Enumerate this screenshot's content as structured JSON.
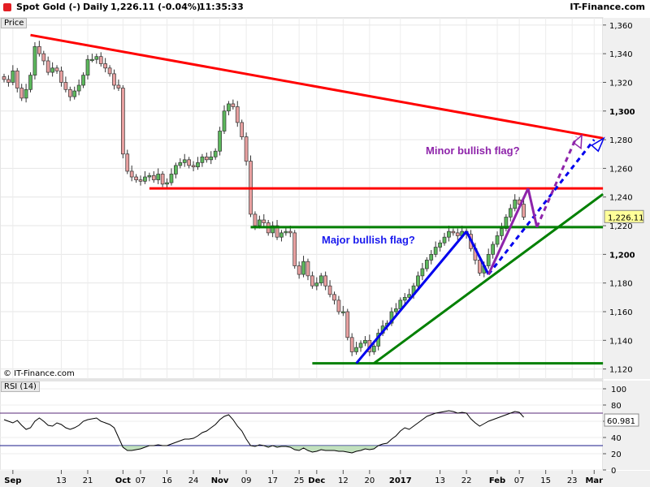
{
  "header": {
    "instrument": "Spot Gold (-)",
    "period": "Daily",
    "quote": "1,226.11 (-0.04%)",
    "time": "11:35:33",
    "brand": "IT-Finance.com"
  },
  "copyright": "© IT-Finance.com",
  "colors": {
    "up_candle": "#5cb85c",
    "down_candle": "#e8a0a0",
    "resistance": "#ff0000",
    "support": "#008000",
    "major_flag": "#0000ee",
    "minor_flag": "#8e24aa"
  },
  "chart_data": [
    {
      "type": "candlestick",
      "panel": "price",
      "ylabel": "Price",
      "ylim": [
        1113,
        1365
      ],
      "yticks": [
        1120,
        1140,
        1160,
        1180,
        1200,
        1220,
        1240,
        1260,
        1280,
        1300,
        1320,
        1340,
        1360
      ],
      "ytick_labels": [
        "1,120",
        "1,140",
        "1,160",
        "1,180",
        "1,200",
        "1,220",
        "1,240",
        "1,260",
        "1,280",
        "1,300",
        "1,320",
        "1,340",
        "1,360"
      ],
      "bold_ticks": [
        "1,200",
        "1,300"
      ],
      "xlim": [
        0,
        133
      ],
      "x_ticks": [
        {
          "i": 2,
          "label": "Sep"
        },
        {
          "i": 13,
          "label": "13"
        },
        {
          "i": 19,
          "label": "21"
        },
        {
          "i": 27,
          "label": "Oct"
        },
        {
          "i": 31,
          "label": "07"
        },
        {
          "i": 37,
          "label": "16"
        },
        {
          "i": 43,
          "label": "24"
        },
        {
          "i": 49,
          "label": "Nov"
        },
        {
          "i": 55,
          "label": "09"
        },
        {
          "i": 61,
          "label": "17"
        },
        {
          "i": 67,
          "label": "25"
        },
        {
          "i": 71,
          "label": "Dec"
        },
        {
          "i": 77,
          "label": "12"
        },
        {
          "i": 83,
          "label": "20"
        },
        {
          "i": 90,
          "label": "2017"
        },
        {
          "i": 99,
          "label": "13"
        },
        {
          "i": 105,
          "label": "22"
        },
        {
          "i": 112,
          "label": "Feb"
        },
        {
          "i": 117,
          "label": "07"
        },
        {
          "i": 123,
          "label": "15"
        },
        {
          "i": 129,
          "label": "23"
        },
        {
          "i": 134,
          "label": "Mar"
        }
      ],
      "bold_x_labels": [
        "Sep",
        "Oct",
        "Nov",
        "Dec",
        "2017",
        "Feb",
        "Mar"
      ],
      "last_price": "1,226.11",
      "close": [
        1322,
        1320,
        1328,
        1316,
        1309,
        1315,
        1325,
        1345,
        1340,
        1335,
        1327,
        1330,
        1328,
        1320,
        1315,
        1310,
        1314,
        1318,
        1325,
        1336,
        1336,
        1338,
        1333,
        1330,
        1326,
        1318,
        1316,
        1270,
        1258,
        1254,
        1252,
        1251,
        1254,
        1255,
        1252,
        1256,
        1249,
        1250,
        1256,
        1262,
        1264,
        1266,
        1262,
        1261,
        1264,
        1268,
        1266,
        1268,
        1272,
        1286,
        1300,
        1305,
        1303,
        1292,
        1282,
        1265,
        1228,
        1220,
        1224,
        1222,
        1215,
        1220,
        1212,
        1215,
        1216,
        1215,
        1192,
        1186,
        1195,
        1185,
        1178,
        1180,
        1185,
        1178,
        1172,
        1168,
        1160,
        1160,
        1142,
        1132,
        1135,
        1138,
        1140,
        1132,
        1136,
        1145,
        1150,
        1152,
        1160,
        1162,
        1168,
        1170,
        1172,
        1178,
        1185,
        1190,
        1196,
        1200,
        1205,
        1208,
        1212,
        1216,
        1215,
        1213,
        1216,
        1214,
        1204,
        1196,
        1187,
        1192,
        1200,
        1207,
        1213,
        1218,
        1226,
        1232,
        1238,
        1235,
        1226
      ],
      "open": [
        1324,
        1322,
        1320,
        1328,
        1316,
        1309,
        1315,
        1325,
        1345,
        1340,
        1335,
        1327,
        1330,
        1328,
        1320,
        1315,
        1310,
        1314,
        1318,
        1325,
        1336,
        1336,
        1338,
        1333,
        1330,
        1326,
        1318,
        1316,
        1270,
        1258,
        1254,
        1252,
        1251,
        1254,
        1255,
        1252,
        1256,
        1249,
        1250,
        1256,
        1262,
        1264,
        1266,
        1262,
        1261,
        1264,
        1268,
        1266,
        1268,
        1272,
        1286,
        1300,
        1305,
        1303,
        1292,
        1282,
        1265,
        1228,
        1220,
        1224,
        1222,
        1215,
        1220,
        1212,
        1215,
        1216,
        1215,
        1192,
        1186,
        1195,
        1185,
        1178,
        1180,
        1185,
        1178,
        1172,
        1168,
        1160,
        1160,
        1142,
        1132,
        1135,
        1138,
        1140,
        1132,
        1136,
        1145,
        1150,
        1152,
        1160,
        1162,
        1168,
        1170,
        1172,
        1178,
        1185,
        1190,
        1196,
        1200,
        1205,
        1208,
        1212,
        1216,
        1215,
        1213,
        1216,
        1214,
        1204,
        1196,
        1187,
        1192,
        1200,
        1207,
        1213,
        1218,
        1226,
        1232,
        1238,
        1235
      ]
    },
    {
      "type": "line",
      "panel": "rsi",
      "name": "RSI (14)",
      "ylim": [
        0,
        110
      ],
      "yticks": [
        0,
        20,
        40,
        60,
        80,
        100
      ],
      "ytick_labels": [
        "0",
        "20",
        "40",
        "60",
        "80",
        "100"
      ],
      "levels": [
        70,
        30
      ],
      "last_value": "60.981",
      "values": [
        62,
        60,
        58,
        61,
        55,
        50,
        52,
        60,
        64,
        60,
        55,
        54,
        58,
        56,
        52,
        50,
        52,
        55,
        60,
        62,
        63,
        64,
        60,
        58,
        56,
        52,
        40,
        28,
        24,
        24,
        25,
        26,
        28,
        30,
        30,
        31,
        30,
        30,
        32,
        34,
        36,
        38,
        38,
        39,
        42,
        46,
        48,
        52,
        56,
        62,
        66,
        68,
        62,
        54,
        48,
        38,
        30,
        29,
        31,
        30,
        28,
        30,
        28,
        29,
        29,
        28,
        25,
        24,
        27,
        24,
        22,
        23,
        25,
        24,
        24,
        24,
        23,
        23,
        22,
        21,
        23,
        24,
        26,
        25,
        26,
        30,
        32,
        33,
        38,
        42,
        48,
        52,
        50,
        54,
        58,
        62,
        66,
        68,
        70,
        71,
        72,
        73,
        72,
        70,
        71,
        70,
        63,
        58,
        54,
        57,
        60,
        62,
        64,
        66,
        68,
        70,
        72,
        71,
        65
      ]
    }
  ],
  "annotations": {
    "minor_flag_label": "Minor bullish flag?",
    "major_flag_label": "Major bullish flag?"
  }
}
